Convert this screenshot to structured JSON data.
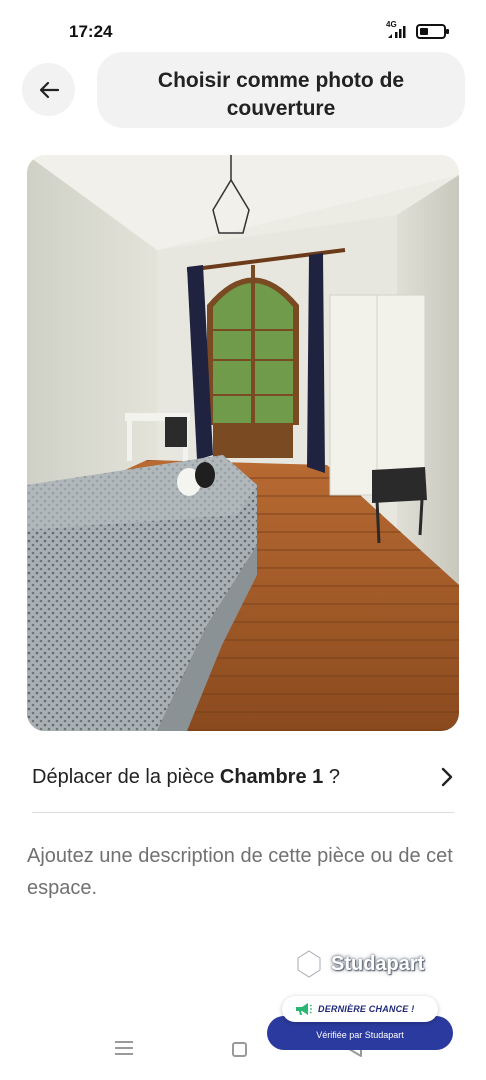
{
  "status_bar": {
    "time": "17:24",
    "network": "4G",
    "battery_level": 0.35,
    "icons": [
      "signal-icon",
      "battery-icon"
    ]
  },
  "header": {
    "back_icon": "arrow-left-icon",
    "title": "Choisir comme photo de couverture"
  },
  "photo": {
    "content": "bedroom-photo"
  },
  "move_row": {
    "prefix": "Déplacer de la pièce ",
    "room": "Chambre 1",
    "suffix": " ?",
    "icon": "chevron-right-icon"
  },
  "description": {
    "text": "Ajoutez une description de cette pièce ou de cet espace."
  },
  "watermark": {
    "text": "Studapart",
    "icon": "studapart-logo-icon"
  },
  "promo": {
    "badge": "DERNIÈRE CHANCE !",
    "verified": "Vérifiée par Studapart",
    "icon": "megaphone-icon"
  },
  "nav_bar": {
    "icons": [
      "menu-icon",
      "home-icon",
      "back-triangle-icon"
    ]
  },
  "colors": {
    "accent": "#2b3a9e",
    "pill_bg": "#f2f2f2",
    "muted_text": "#717171"
  }
}
